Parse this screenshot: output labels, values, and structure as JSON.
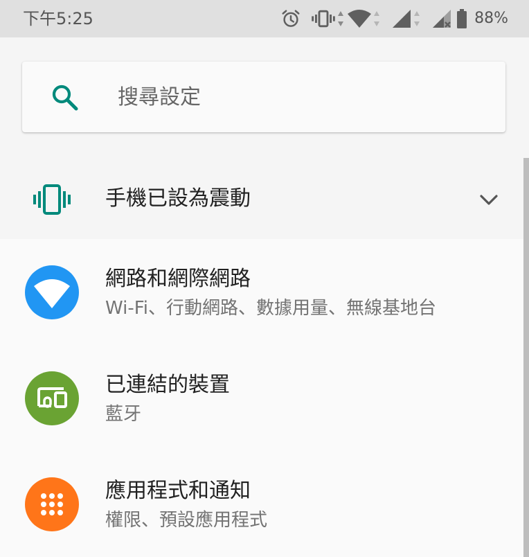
{
  "status_bar": {
    "time": "下午5:25",
    "battery_percent": "88%",
    "icons": [
      "alarm-icon",
      "vibrate-icon",
      "data-arrows-icon",
      "wifi-icon",
      "cell-signal-icon",
      "cell-signal-no-sim-icon",
      "battery-icon"
    ]
  },
  "search": {
    "placeholder": "搜尋設定",
    "icon": "search-icon"
  },
  "condition": {
    "icon": "vibrate-icon",
    "title": "手機已設為震動",
    "expand_icon": "chevron-down-icon"
  },
  "settings": [
    {
      "icon": "wifi-icon",
      "icon_color": "#2196f3",
      "title": "網路和網際網路",
      "summary": "Wi-Fi、行動網路、數據用量、無線基地台"
    },
    {
      "icon": "connected-devices-icon",
      "icon_color": "#6aa333",
      "title": "已連結的裝置",
      "summary": "藍牙"
    },
    {
      "icon": "apps-grid-icon",
      "icon_color": "#ff7519",
      "title": "應用程式和通知",
      "summary": "權限、預設應用程式"
    }
  ],
  "colors": {
    "accent": "#00897b",
    "status_bar_bg": "#e0e0e0"
  }
}
